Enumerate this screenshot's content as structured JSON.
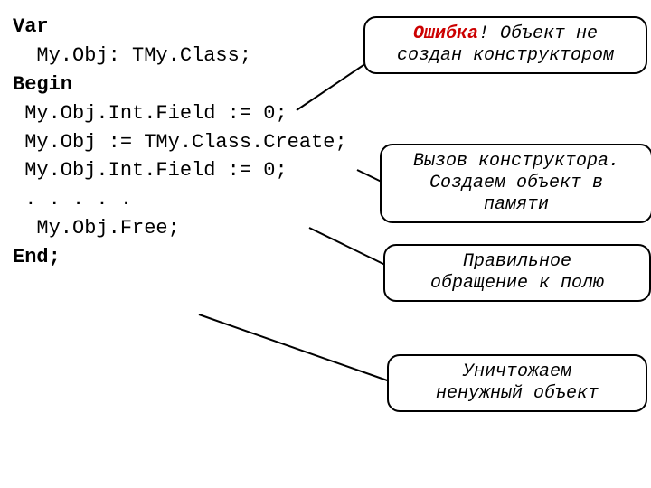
{
  "code": {
    "l1": "Var",
    "l2": "  My.Obj: TMy.Class;",
    "l3": "Begin",
    "l4": " My.Obj.Int.Field := 0;",
    "l5": "",
    "l6": " My.Obj := TMy.Class.Create;",
    "l7": "",
    "l8": " My.Obj.Int.Field := 0;",
    "l9": "",
    "l10": " . . . . .",
    "l11": "  My.Obj.Free;",
    "l12": "",
    "l13": "End;"
  },
  "callouts": {
    "c1_err": "Ошибка",
    "c1_rest": "! Объект не",
    "c1_line2": "создан конструктором",
    "c2_line1": "Вызов конструктора.",
    "c2_line2": "Создаем объект в",
    "c2_line3": "памяти",
    "c3_line1": "Правильное",
    "c3_line2": "обращение к полю",
    "c4_line1": "Уничтожаем",
    "c4_line2": "ненужный объект"
  }
}
